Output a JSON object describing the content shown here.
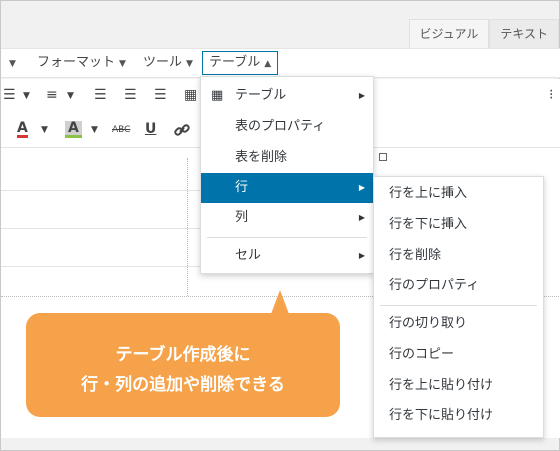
{
  "editor_tabs": {
    "visual": "ビジュアル",
    "text": "テキスト"
  },
  "menubar": {
    "format": "フォーマット",
    "tools": "ツール",
    "table": "テーブル"
  },
  "table_menu": {
    "items": [
      "テーブル",
      "表のプロパティ",
      "表を削除",
      "行",
      "列",
      "セル"
    ]
  },
  "row_submenu": {
    "items": [
      "行を上に挿入",
      "行を下に挿入",
      "行を削除",
      "行のプロパティ",
      "行の切り取り",
      "行のコピー",
      "行を上に貼り付け",
      "行を下に貼り付け"
    ]
  },
  "toolbar": {
    "strikethrough": "ABC"
  },
  "callout": {
    "line1": "テーブル作成後に",
    "line2": "行・列の追加や削除できる"
  },
  "colors": {
    "highlight": "#0073aa",
    "callout": "#f6a24a",
    "text_color_bar": "#d63638",
    "bg_color_bar": "#8bc34a"
  }
}
